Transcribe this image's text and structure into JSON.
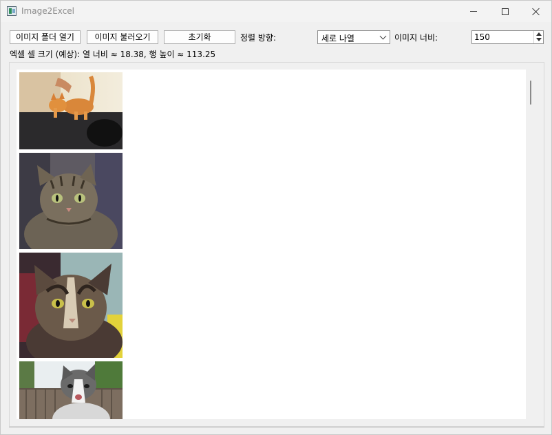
{
  "window": {
    "title": "Image2Excel"
  },
  "toolbar": {
    "open_folder_label": "이미지 폴더 열기",
    "load_images_label": "이미지 불러오기",
    "reset_label": "초기화",
    "sort_direction_label": "정렬 방향:",
    "sort_direction_value": "세로 나열",
    "image_width_label": "이미지 너비:",
    "image_width_value": "150"
  },
  "info": {
    "cell_size_text": "엑셀 셀 크기 (예상): 열 너비 ≈ 18.38, 행 높이 ≈ 113.25"
  },
  "images": [
    {
      "name": "cat-image-1",
      "description": "orange kitten on table"
    },
    {
      "name": "cat-image-2",
      "description": "tabby cat"
    },
    {
      "name": "cat-image-3",
      "description": "tortoiseshell cat"
    },
    {
      "name": "cat-image-4",
      "description": "gray and white cat outdoors"
    }
  ],
  "icons": {
    "app": "app-icon",
    "minimize": "minimize-icon",
    "maximize": "maximize-icon",
    "close": "close-icon",
    "dropdown": "chevron-down-icon",
    "spin_up": "spin-up-icon",
    "spin_down": "spin-down-icon"
  }
}
